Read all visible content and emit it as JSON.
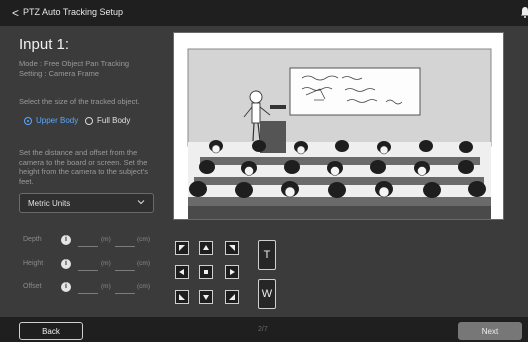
{
  "header": {
    "back_glyph": "<",
    "title": "PTZ Auto Tracking Setup",
    "bell_icon": "bell-icon"
  },
  "main": {
    "heading": "Input 1:",
    "mode_line1": "Mode : Free Object Pan Tracking",
    "mode_line2": "Setting : Camera Frame",
    "size_prompt": "Select the size of the tracked object.",
    "size_options": [
      "Upper Body",
      "Full Body"
    ],
    "size_selected": "Upper Body",
    "distance_instructions": "Set the distance and offset from the camera to the board or screen. Set the height from the camera to the subject's feet.",
    "units": {
      "selected": "Metric Units"
    },
    "measurements": [
      {
        "label": "Depth",
        "unit1": "(m)",
        "unit2": "(cm)"
      },
      {
        "label": "Height",
        "unit1": "(m)",
        "unit2": "(cm)"
      },
      {
        "label": "Offset",
        "unit1": "(m)",
        "unit2": "(cm)"
      }
    ],
    "info_glyph": "i"
  },
  "ptz": {
    "arrows": [
      "up-left",
      "up",
      "up-right",
      "left",
      "home",
      "right",
      "down-left",
      "down",
      "down-right"
    ],
    "tele": "T",
    "wide": "W"
  },
  "footer": {
    "back": "Back",
    "page": "2/7",
    "next": "Next"
  },
  "colors": {
    "accent": "#58a8ff",
    "background": "#3b3b3b",
    "bar": "#1f1f1f",
    "next_button": "#777777"
  }
}
